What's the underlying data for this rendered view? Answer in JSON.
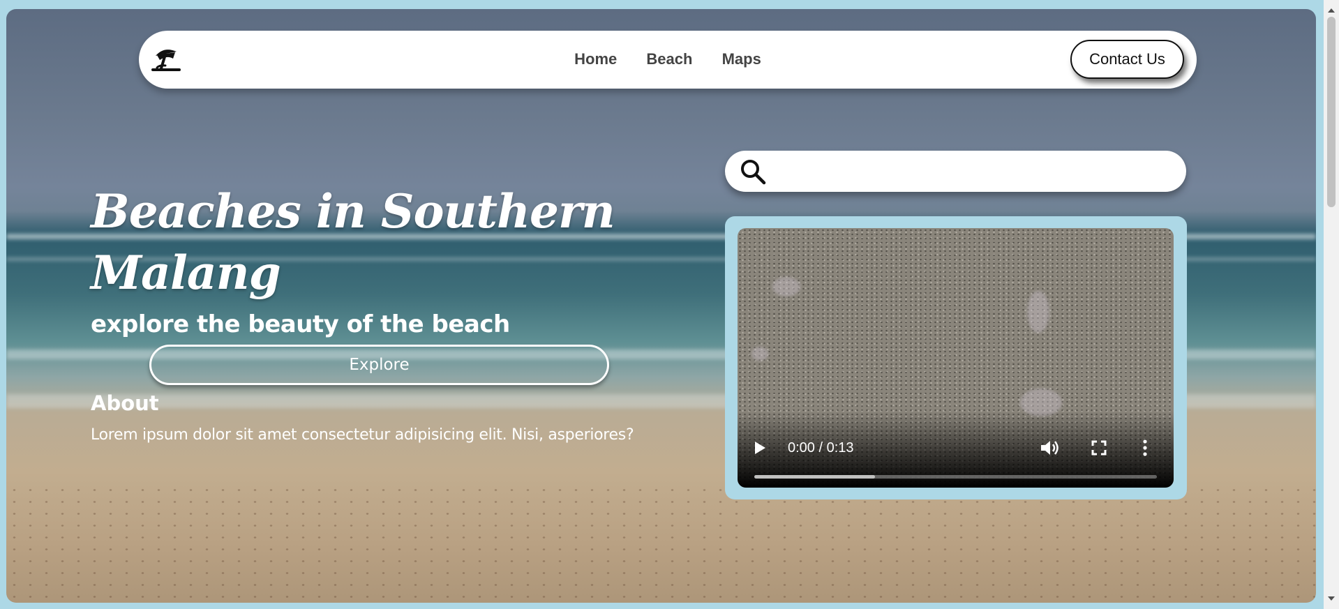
{
  "navbar": {
    "logo_icon": "beach-umbrella-icon",
    "links": [
      "Home",
      "Beach",
      "Maps"
    ],
    "contact_label": "Contact Us"
  },
  "hero": {
    "title": "Beaches in Southern Malang",
    "subtitle": "explore the beauty of the beach",
    "explore_label": "Explore",
    "about_heading": "About",
    "about_text": "Lorem ipsum dolor sit amet consectetur adipisicing elit. Nisi, asperiores?"
  },
  "search": {
    "icon": "search-icon",
    "value": ""
  },
  "video": {
    "time": "0:00 / 0:13",
    "buffered_fraction": 0.3,
    "controls": [
      "play-icon",
      "volume-icon",
      "fullscreen-icon",
      "more-options-icon"
    ]
  },
  "colors": {
    "page_background": "#add8e6",
    "navbar_background": "#ffffff",
    "nav_text": "#444444",
    "hero_text": "#ffffff"
  }
}
